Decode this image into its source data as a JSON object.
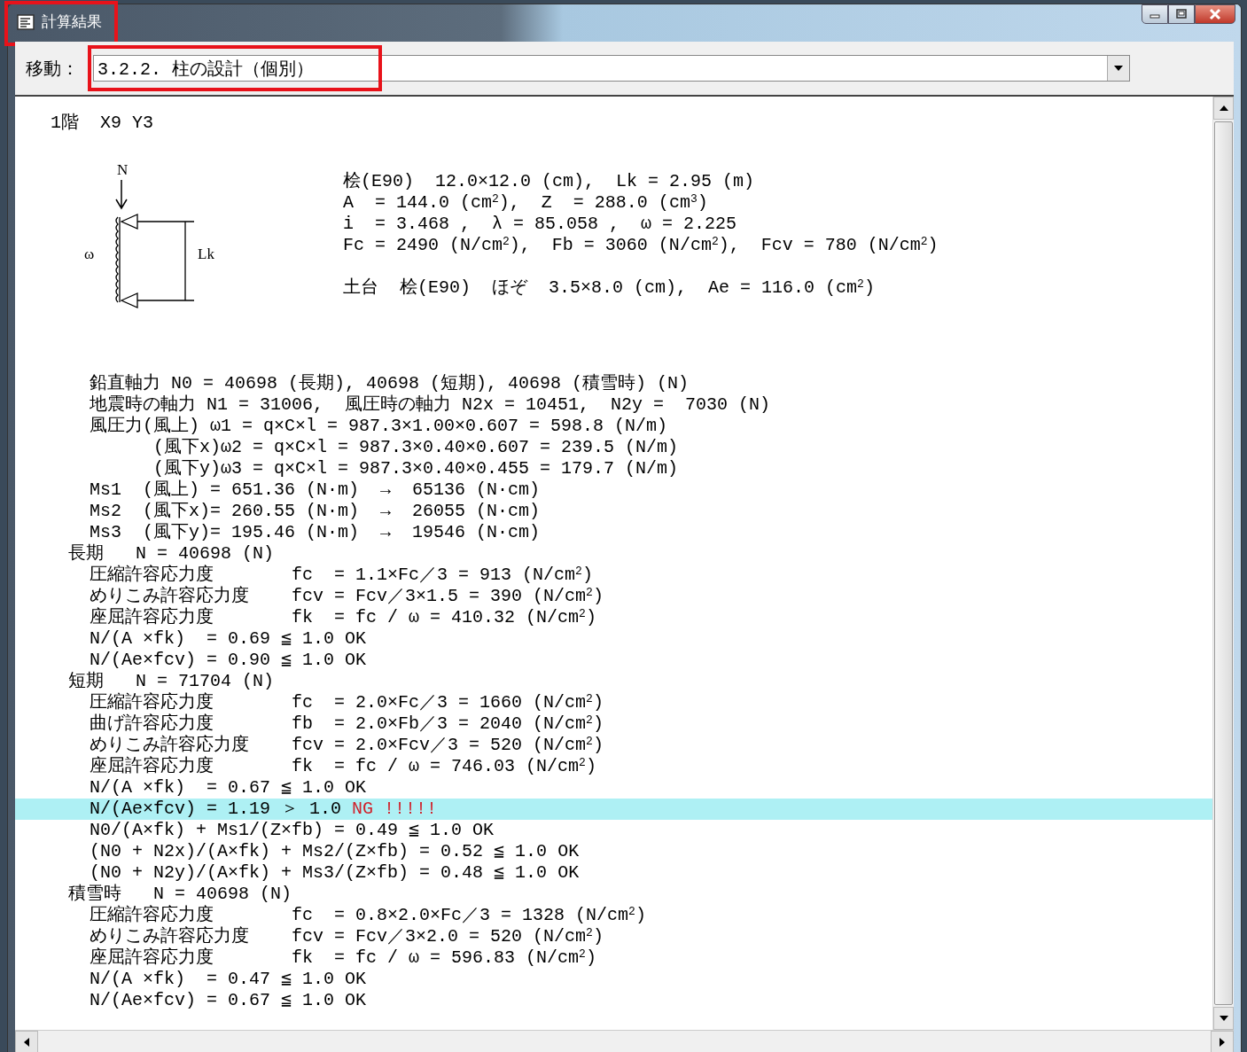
{
  "window": {
    "title": "計算結果"
  },
  "jump": {
    "label": "移動：",
    "value": "3.2.2. 柱の設計（個別）"
  },
  "heading": "1階  X9 Y3",
  "diagram": {
    "load_label": "N",
    "coef_label": "ω",
    "length_label": "Lk"
  },
  "member": [
    "桧(E90)  12.0×12.0 (cm),  Lk = 2.95 (m)",
    "A  = 144.0 (cm$^{2}$),  Z  = 288.0 (cm$^{3}$)",
    "i  = 3.468 ,  λ = 85.058 ,  ω = 2.225",
    "Fc = 2490 (N/cm$^{2}$),  Fb = 3060 (N/cm$^{2}$),  Fcv = 780 (N/cm$^{2}$)"
  ],
  "sill": "土台  桧(E90)  ほぞ  3.5×8.0 (cm),  Ae = 116.0 (cm$^{2}$)",
  "loads": [
    {
      "kind": "line",
      "text": "鉛直軸力 N0 = 40698 (長期), 40698 (短期), 40698 (積雪時) (N)"
    },
    {
      "kind": "line",
      "text": "地震時の軸力 N1 = 31006,  風圧時の軸力 N2x = 10451,  N2y =  7030 (N)"
    },
    {
      "kind": "line",
      "text": "風圧力(風上) ω1 = q×C×l = 987.3×1.00×0.607 = 598.8 (N/m)"
    },
    {
      "kind": "continuation",
      "text": "(風下x)ω2 = q×C×l = 987.3×0.40×0.607 = 239.5 (N/m)"
    },
    {
      "kind": "continuation",
      "text": "(風下y)ω3 = q×C×l = 987.3×0.40×0.455 = 179.7 (N/m)"
    },
    {
      "kind": "line",
      "text": "Ms1  (風上) = 651.36 (N·m)  →  65136 (N·cm)"
    },
    {
      "kind": "line",
      "text": "Ms2  (風下x)= 260.55 (N·m)  →  26055 (N·cm)"
    },
    {
      "kind": "line",
      "text": "Ms3  (風下y)= 195.46 (N·m)  →  19546 (N·cm)"
    }
  ],
  "sections": [
    {
      "label": "長期",
      "value": "N = 40698 (N)",
      "items": [
        {
          "kind": "stress",
          "label": "圧縮許容応力度",
          "formula": "fc  = 1.1×Fc／3 = 913 (N/cm$^{2}$)"
        },
        {
          "kind": "stress",
          "label": "めりこみ許容応力度",
          "formula": "fcv = Fcv／3×1.5 = 390 (N/cm$^{2}$)"
        },
        {
          "kind": "stress",
          "label": "座屈許容応力度",
          "formula": "fk  = fc / ω = 410.32 (N/cm$^{2}$)"
        },
        {
          "kind": "check",
          "text": "N/(A ×fk)  = 0.69 ≦ 1.0 OK",
          "selected": false
        },
        {
          "kind": "check",
          "text": "N/(Ae×fcv) = 0.90 ≦ 1.0 OK",
          "selected": false
        }
      ]
    },
    {
      "label": "短期",
      "value": "N = 71704 (N)",
      "items": [
        {
          "kind": "stress",
          "label": "圧縮許容応力度",
          "formula": "fc  = 2.0×Fc／3 = 1660 (N/cm$^{2}$)"
        },
        {
          "kind": "stress",
          "label": "曲げ許容応力度",
          "formula": "fb  = 2.0×Fb／3 = 2040 (N/cm$^{2}$)"
        },
        {
          "kind": "stress",
          "label": "めりこみ許容応力度",
          "formula": "fcv = 2.0×Fcv／3 = 520 (N/cm$^{2}$)"
        },
        {
          "kind": "stress",
          "label": "座屈許容応力度",
          "formula": "fk  = fc / ω = 746.03 (N/cm$^{2}$)"
        },
        {
          "kind": "check",
          "text": "N/(A ×fk)  = 0.67 ≦ 1.0 OK",
          "selected": false
        },
        {
          "kind": "check",
          "text": "N/(Ae×fcv) = 1.19 ＞ 1.0",
          "verdict": "NG !!!!!",
          "selected": true
        },
        {
          "kind": "check",
          "text": "N0/(A×fk) + Ms1/(Z×fb) = 0.49 ≦ 1.0 OK",
          "selected": false
        },
        {
          "kind": "check",
          "text": "(N0 + N2x)/(A×fk) + Ms2/(Z×fb) = 0.52 ≦ 1.0 OK",
          "selected": false
        },
        {
          "kind": "check",
          "text": "(N0 + N2y)/(A×fk) + Ms3/(Z×fb) = 0.48 ≦ 1.0 OK",
          "selected": false
        }
      ]
    },
    {
      "label": "積雪時",
      "value": "N = 40698 (N)",
      "items": [
        {
          "kind": "stress",
          "label": "圧縮許容応力度",
          "formula": "fc  = 0.8×2.0×Fc／3 = 1328 (N/cm$^{2}$)"
        },
        {
          "kind": "stress",
          "label": "めりこみ許容応力度",
          "formula": "fcv = Fcv／3×2.0 = 520 (N/cm$^{2}$)"
        },
        {
          "kind": "stress",
          "label": "座屈許容応力度",
          "formula": "fk  = fc / ω = 596.83 (N/cm$^{2}$)"
        },
        {
          "kind": "check",
          "text": "N/(A ×fk)  = 0.47 ≦ 1.0 OK",
          "selected": false
        },
        {
          "kind": "check",
          "text": "N/(Ae×fcv) = 0.67 ≦ 1.0 OK",
          "selected": false
        }
      ]
    }
  ]
}
